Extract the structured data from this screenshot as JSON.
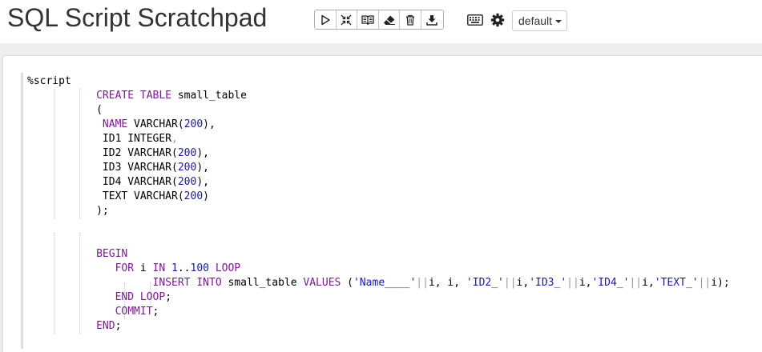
{
  "header": {
    "title": "SQL Script Scratchpad",
    "toolbar": [
      {
        "name": "run-button",
        "icon": "play-icon"
      },
      {
        "name": "collapse-button",
        "icon": "compress-icon"
      },
      {
        "name": "book-button",
        "icon": "book-icon"
      },
      {
        "name": "clear-button",
        "icon": "eraser-icon"
      },
      {
        "name": "delete-button",
        "icon": "trash-icon"
      },
      {
        "name": "download-button",
        "icon": "download-icon"
      }
    ],
    "keyboard_icon": "keyboard-icon",
    "settings_icon": "gear-icon",
    "interpreter": {
      "selected": "default"
    }
  },
  "editor": {
    "lines": [
      [
        {
          "t": "%script",
          "c": "plain"
        }
      ],
      [
        {
          "t": "           ",
          "c": "plain"
        },
        {
          "t": "CREATE TABLE",
          "c": "kw"
        },
        {
          "t": " small_table",
          "c": "plain"
        }
      ],
      [
        {
          "t": "           (",
          "c": "plain"
        }
      ],
      [
        {
          "t": "            ",
          "c": "plain"
        },
        {
          "t": "NAME",
          "c": "kw"
        },
        {
          "t": " VARCHAR(",
          "c": "plain"
        },
        {
          "t": "200",
          "c": "num"
        },
        {
          "t": "),",
          "c": "plain"
        }
      ],
      [
        {
          "t": "            ID1 INTEGER",
          "c": "plain"
        },
        {
          "t": ",",
          "c": "op"
        }
      ],
      [
        {
          "t": "            ID2 VARCHAR(",
          "c": "plain"
        },
        {
          "t": "200",
          "c": "num"
        },
        {
          "t": "),",
          "c": "plain"
        }
      ],
      [
        {
          "t": "            ID3 VARCHAR(",
          "c": "plain"
        },
        {
          "t": "200",
          "c": "num"
        },
        {
          "t": "),",
          "c": "plain"
        }
      ],
      [
        {
          "t": "            ID4 VARCHAR(",
          "c": "plain"
        },
        {
          "t": "200",
          "c": "num"
        },
        {
          "t": "),",
          "c": "plain"
        }
      ],
      [
        {
          "t": "            TEXT VARCHAR(",
          "c": "plain"
        },
        {
          "t": "200",
          "c": "num"
        },
        {
          "t": ")",
          "c": "plain"
        }
      ],
      [
        {
          "t": "           );",
          "c": "plain"
        }
      ],
      [],
      [],
      [
        {
          "t": "           ",
          "c": "plain"
        },
        {
          "t": "BEGIN",
          "c": "kw"
        }
      ],
      [
        {
          "t": "              ",
          "c": "plain"
        },
        {
          "t": "FOR",
          "c": "kw"
        },
        {
          "t": " i ",
          "c": "plain"
        },
        {
          "t": "IN",
          "c": "kw"
        },
        {
          "t": " ",
          "c": "plain"
        },
        {
          "t": "1",
          "c": "num"
        },
        {
          "t": "..",
          "c": "plain"
        },
        {
          "t": "100",
          "c": "num"
        },
        {
          "t": " ",
          "c": "plain"
        },
        {
          "t": "LOOP",
          "c": "kw"
        }
      ],
      [
        {
          "t": "                    ",
          "c": "plain"
        },
        {
          "t": "INSERT INTO",
          "c": "kw"
        },
        {
          "t": " small_table ",
          "c": "plain"
        },
        {
          "t": "VALUES",
          "c": "kw"
        },
        {
          "t": " (",
          "c": "plain"
        },
        {
          "t": "'Name____'",
          "c": "str"
        },
        {
          "t": "||",
          "c": "op"
        },
        {
          "t": "i, i, ",
          "c": "plain"
        },
        {
          "t": "'ID2_'",
          "c": "str"
        },
        {
          "t": "||",
          "c": "op"
        },
        {
          "t": "i,",
          "c": "plain"
        },
        {
          "t": "'ID3_'",
          "c": "str"
        },
        {
          "t": "||",
          "c": "op"
        },
        {
          "t": "i,",
          "c": "plain"
        },
        {
          "t": "'ID4_'",
          "c": "str"
        },
        {
          "t": "||",
          "c": "op"
        },
        {
          "t": "i,",
          "c": "plain"
        },
        {
          "t": "'TEXT_'",
          "c": "str"
        },
        {
          "t": "||",
          "c": "op"
        },
        {
          "t": "i);",
          "c": "plain"
        }
      ],
      [
        {
          "t": "              ",
          "c": "plain"
        },
        {
          "t": "END LOOP",
          "c": "kw"
        },
        {
          "t": ";",
          "c": "plain"
        }
      ],
      [
        {
          "t": "              ",
          "c": "plain"
        },
        {
          "t": "COMMIT",
          "c": "kw"
        },
        {
          "t": ";",
          "c": "plain"
        }
      ],
      [
        {
          "t": "           ",
          "c": "plain"
        },
        {
          "t": "END",
          "c": "kw"
        },
        {
          "t": ";",
          "c": "plain"
        }
      ]
    ]
  }
}
